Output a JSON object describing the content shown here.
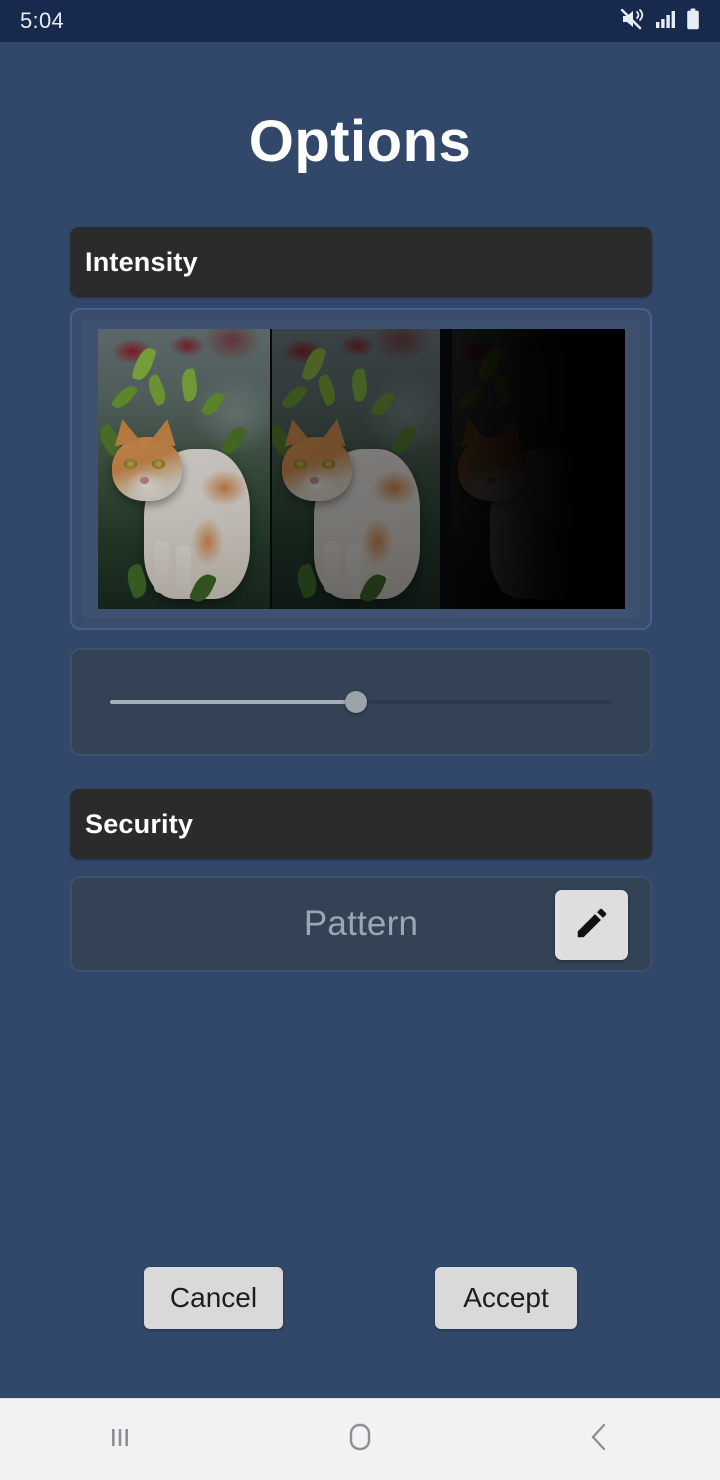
{
  "status_bar": {
    "time": "5:04",
    "icons": [
      "mute-vibrate-icon",
      "signal-bars-icon",
      "battery-full-icon"
    ]
  },
  "header": {
    "title": "Options"
  },
  "theme": {
    "background": "#32486a",
    "status_bar_background": "#17294d",
    "section_header_background": "#2b2b2b",
    "card_background": "#344256",
    "card_border": "#3e506b",
    "button_background": "#d9d9d9",
    "slider_thumb": "#9aa3a8",
    "slider_fill": "#a7b0b4",
    "nav_bar_background": "#f2f2f2"
  },
  "sections": {
    "intensity": {
      "header_label": "Intensity",
      "preview": {
        "name": "intensity-preview",
        "description": "cat photo shown at three dimming levels",
        "panels": [
          {
            "label": "none",
            "brightness_percent": 100
          },
          {
            "label": "medium",
            "brightness_percent": 62
          },
          {
            "label": "maximum",
            "brightness_percent": 17
          }
        ]
      },
      "slider": {
        "name": "intensity-slider",
        "value_percent": 49,
        "min": 0,
        "max": 100
      }
    },
    "security": {
      "header_label": "Security",
      "method": {
        "label": "Pattern",
        "edit_icon": "pencil-edit-icon"
      }
    }
  },
  "footer": {
    "cancel_label": "Cancel",
    "accept_label": "Accept"
  },
  "nav_bar": {
    "recents_icon": "recents-icon",
    "home_icon": "home-icon",
    "back_icon": "back-chevron-icon"
  }
}
